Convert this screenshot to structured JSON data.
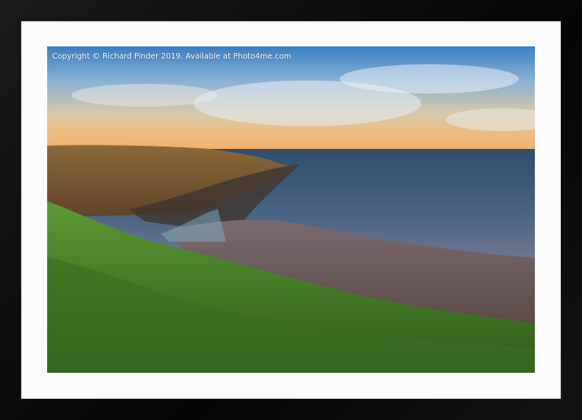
{
  "watermark": {
    "text": "Copyright  © Richard Pinder  2019. Available at Photo4me.com"
  }
}
